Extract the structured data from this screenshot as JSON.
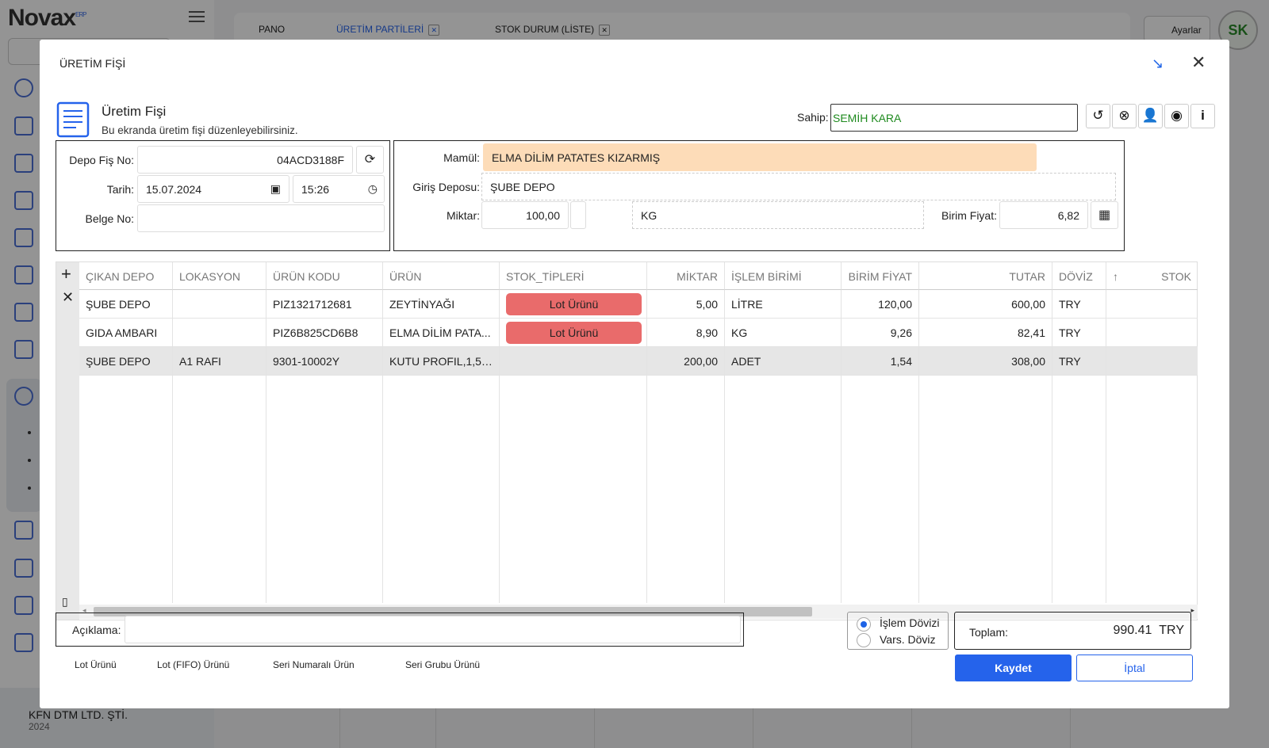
{
  "app": {
    "logo": "Novax",
    "logo_sup": "ERP",
    "tabs": [
      {
        "label": "PANO"
      },
      {
        "label": "ÜRETİM PARTİLERİ",
        "active": true
      },
      {
        "label": "STOK DURUM (LİSTE)"
      }
    ],
    "settings_label": "Ayarlar",
    "avatar_initials": "SK",
    "company": {
      "name": "KFN DTM LTD. ŞTİ.",
      "year": "2024"
    },
    "accent_color": "#2563eb"
  },
  "modal": {
    "title": "ÜRETİM FİŞİ",
    "header_title": "Üretim Fişi",
    "header_subtitle": "Bu ekranda üretim fişi düzenleyebilirsiniz.",
    "owner_label": "Sahip:",
    "owner_value": "SEMİH KARA",
    "toolbar_icons": [
      "undo-icon",
      "user-x-icon",
      "user-lock-icon",
      "user-circle-icon",
      "info-icon"
    ],
    "left_form": {
      "depo_fis_no_label": "Depo Fiş No:",
      "depo_fis_no": "04ACD3188F",
      "tarih_label": "Tarih:",
      "tarih": "15.07.2024",
      "saat": "15:26",
      "belge_no_label": "Belge No:",
      "belge_no": ""
    },
    "right_form": {
      "mamul_label": "Mamül:",
      "mamul": "ELMA DİLİM PATATES KIZARMIŞ",
      "giris_deposu_label": "Giriş Deposu:",
      "giris_deposu": "ŞUBE DEPO",
      "miktar_label": "Miktar:",
      "miktar": "100,00",
      "birim": "KG",
      "birim_fiyat_label": "Birim Fiyat:",
      "birim_fiyat": "6,82",
      "mamul_bg": "#fddcb8"
    },
    "grid": {
      "headers": [
        "ÇIKAN DEPO",
        "LOKASYON",
        "ÜRÜN KODU",
        "ÜRÜN",
        "STOK_TİPLERİ",
        "MİKTAR",
        "İŞLEM BİRİMİ",
        "BİRİM FİYAT",
        "TUTAR",
        "DÖVİZ",
        "↑",
        "STOK"
      ],
      "rows": [
        {
          "cikan_depo": "ŞUBE DEPO",
          "lokasyon": "",
          "urun_kodu": "PIZ1321712681",
          "urun": "ZEYTİNYAĞI",
          "stok_tipi": "Lot Ürünü",
          "miktar": "5,00",
          "islem_birimi": "LİTRE",
          "birim_fiyat": "120,00",
          "tutar": "600,00",
          "doviz": "TRY"
        },
        {
          "cikan_depo": "GIDA AMBARI",
          "lokasyon": "",
          "urun_kodu": "PIZ6B825CD6B8",
          "urun": "ELMA DİLİM PATA...",
          "stok_tipi": "Lot Ürünü",
          "miktar": "8,90",
          "islem_birimi": "KG",
          "birim_fiyat": "9,26",
          "tutar": "82,41",
          "doviz": "TRY"
        },
        {
          "cikan_depo": "ŞUBE DEPO",
          "lokasyon": "A1 RAFI",
          "urun_kodu": "9301-10002Y",
          "urun": "KUTU PROFIL,1,5×...",
          "stok_tipi": "",
          "miktar": "200,00",
          "islem_birimi": "ADET",
          "birim_fiyat": "1,54",
          "tutar": "308,00",
          "doviz": "TRY",
          "selected": true
        }
      ],
      "lot_color": "#e96b6b"
    },
    "footer": {
      "aciklama_label": "Açıklama:",
      "aciklama": "",
      "islem_dovizi_label": "İşlem Dövizi",
      "vars_doviz_label": "Vars. Döviz",
      "toplam_label": "Toplam:",
      "toplam_value": "990.41",
      "toplam_currency": "TRY",
      "save_label": "Kaydet",
      "cancel_label": "İptal",
      "legend": [
        "Lot Ürünü",
        "Lot (FIFO) Ürünü",
        "Seri Numaralı Ürün",
        "Seri Grubu Ürünü"
      ]
    }
  }
}
